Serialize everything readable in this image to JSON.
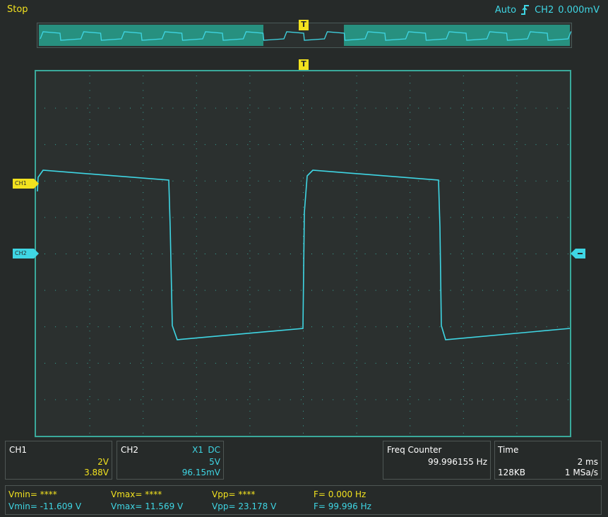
{
  "status": "Stop",
  "trigger": {
    "mode": "Auto",
    "edge_icon": "rising-edge-icon",
    "source": "CH2",
    "level": "0.000mV",
    "marker": "T"
  },
  "channel_markers": {
    "ch1": "CH1",
    "ch2": "CH2"
  },
  "colors": {
    "ch1": "#f2e21f",
    "ch2": "#3fd6e4",
    "grid": "#3aa99b"
  },
  "ch1_panel": {
    "title": "CH1",
    "scale": "2V",
    "offset": "3.88V"
  },
  "ch2_panel": {
    "title": "CH2",
    "probe": "X1",
    "coupling": "DC",
    "scale": "5V",
    "offset": "96.15mV"
  },
  "freq_counter": {
    "title": "Freq Counter",
    "value": "99.996155 Hz"
  },
  "time_panel": {
    "title": "Time",
    "timebase": "2 ms",
    "memory": "128KB",
    "sample_rate": "1 MSa/s"
  },
  "measurements": {
    "ch1": {
      "vmin": "Vmin= ****",
      "vmax": "Vmax= ****",
      "vpp": "Vpp= ****",
      "freq": "F= 0.000 Hz"
    },
    "ch2": {
      "vmin": "Vmin= -11.609 V",
      "vmax": "Vmax= 11.569 V",
      "vpp": "Vpp= 23.178 V",
      "freq": "F= 99.996 Hz"
    }
  }
}
